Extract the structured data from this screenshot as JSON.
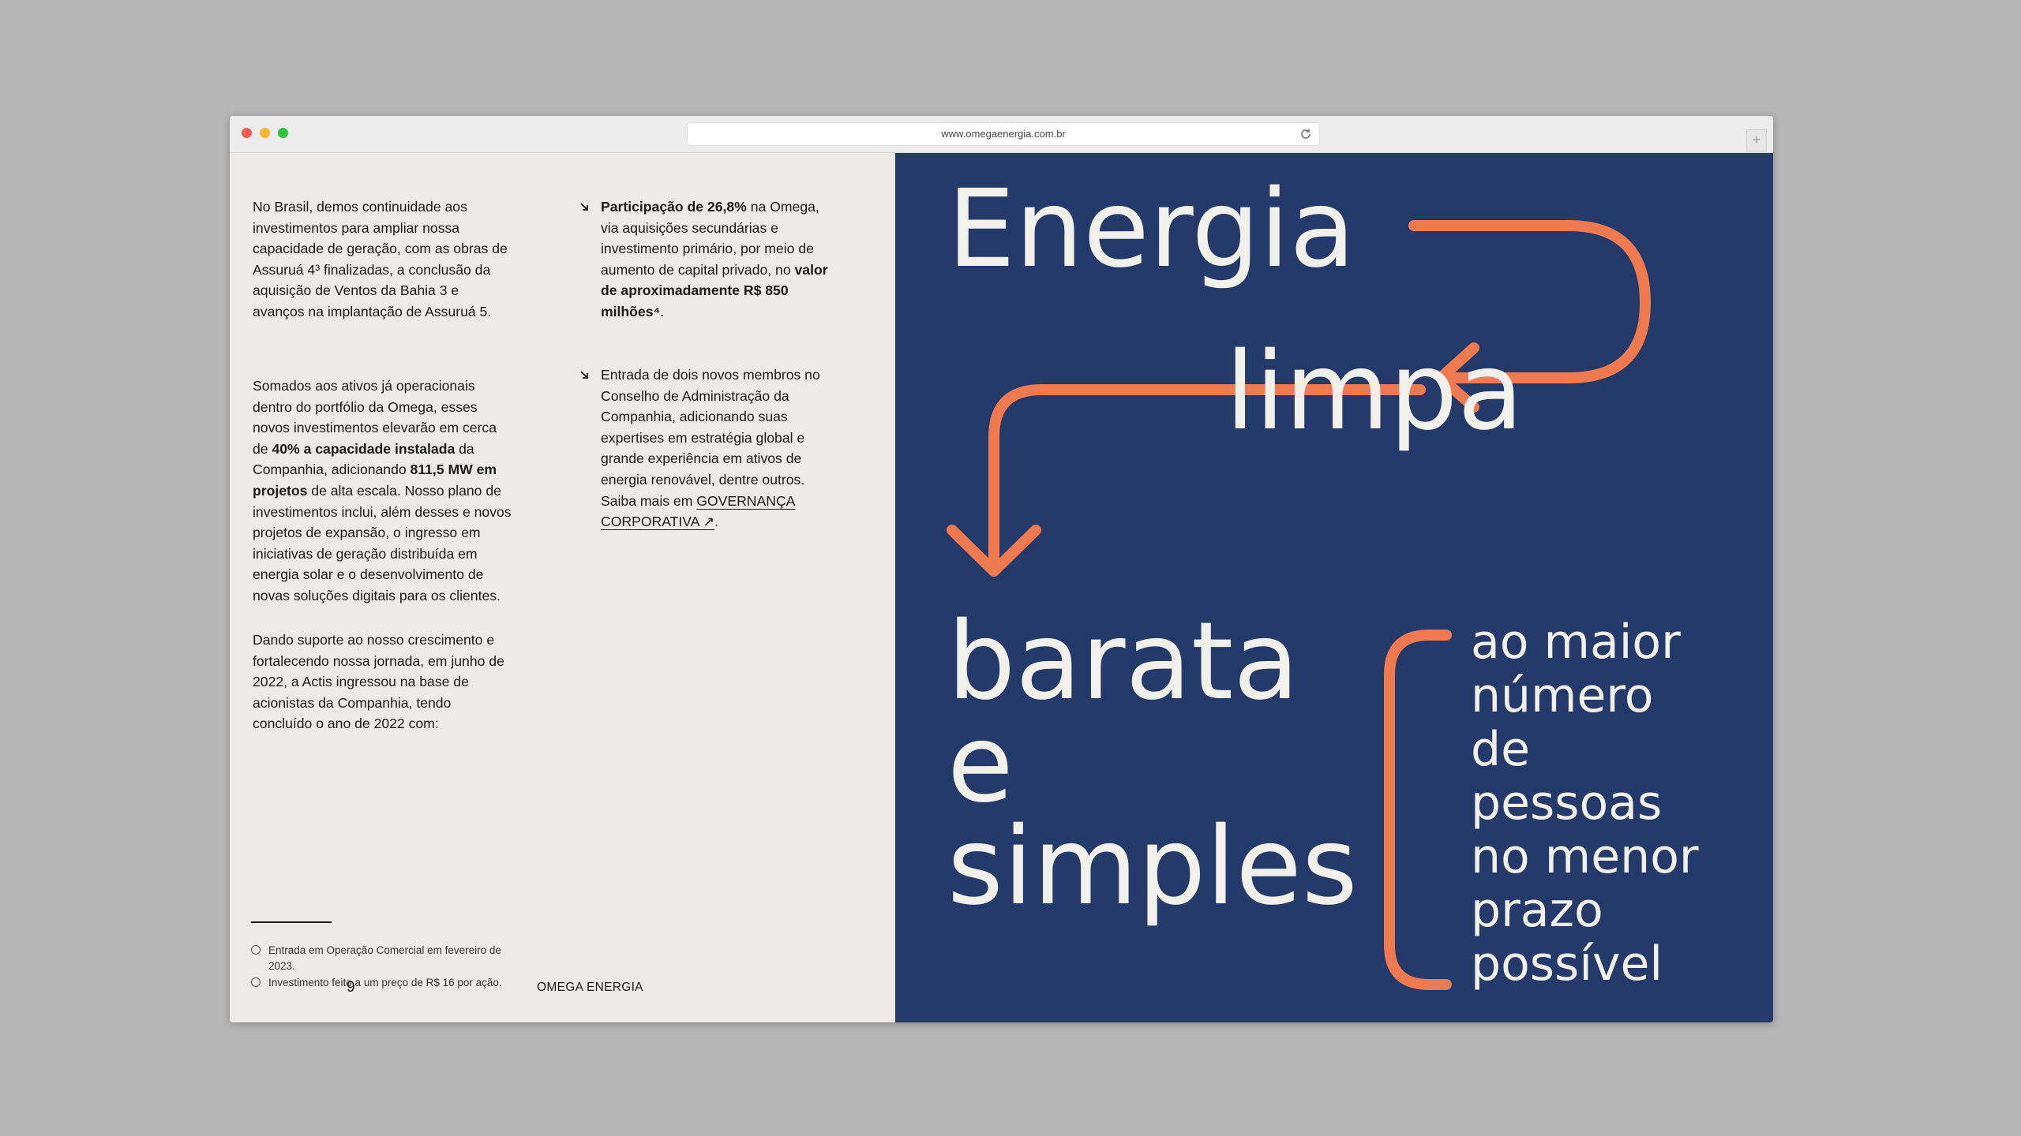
{
  "browser": {
    "url": "www.omegaenergia.com.br",
    "new_tab_label": "+"
  },
  "left": {
    "col1": {
      "p1": "No Brasil, demos continuidade aos investimentos para ampliar nossa capacidade de geração, com as obras de Assuruá 4³ finalizadas, a conclusão da aquisição de Ventos da Bahia 3 e avanços na implantação de Assuruá 5.",
      "p2_a": "Somados aos ativos já operacionais dentro do portfólio da Omega, esses novos investimentos elevarão em cerca de ",
      "p2_b": "40% a capacidade instalada",
      "p2_c": " da Companhia, adicionando ",
      "p2_d": "811,5 MW em projetos",
      "p2_e": " de alta escala. Nosso plano de investimentos inclui, além desses e novos projetos de expansão, o ingresso em iniciativas de geração distribuída em energia solar e o desenvolvimento de novas soluções digitais para os clientes.",
      "p3": "Dando suporte ao nosso crescimento e fortalecendo nossa jornada, em junho de 2022, a Actis ingressou na base de acionistas da Companhia, tendo concluído o ano de 2022 com:"
    },
    "col2": {
      "b1_a": "Participação de 26,8%",
      "b1_b": " na Omega, via aquisições secundárias e investimento primário, por meio de aumento de capital privado, no ",
      "b1_c": "valor de aproximadamente R$ 850 milhões⁴",
      "b1_d": ".",
      "b2_a": "Entrada de dois novos membros no Conselho de Administração da Companhia, adicionando suas expertises em estratégia global e grande experiência em ativos de energia renovável, dentre outros.  Saiba mais em ",
      "b2_link": "GOVERNANÇA CORPORATIVA ↗",
      "b2_end": "."
    },
    "footnotes": [
      "Entrada em Operação Comercial em fevereiro de 2023.",
      "Investimento feito a um preço de R$ 16 por ação."
    ],
    "page_number": "9",
    "brand": "OMEGA ENERGIA"
  },
  "right": {
    "word1": "Energia",
    "word2": "limpa",
    "word3": "barata",
    "word4": "e",
    "word5": "simples",
    "stack": [
      "ao maior",
      "número",
      "de",
      "pessoas",
      "no menor",
      "prazo",
      "possível"
    ],
    "accent_color": "#f07a4f",
    "background_color": "#243a6a"
  }
}
